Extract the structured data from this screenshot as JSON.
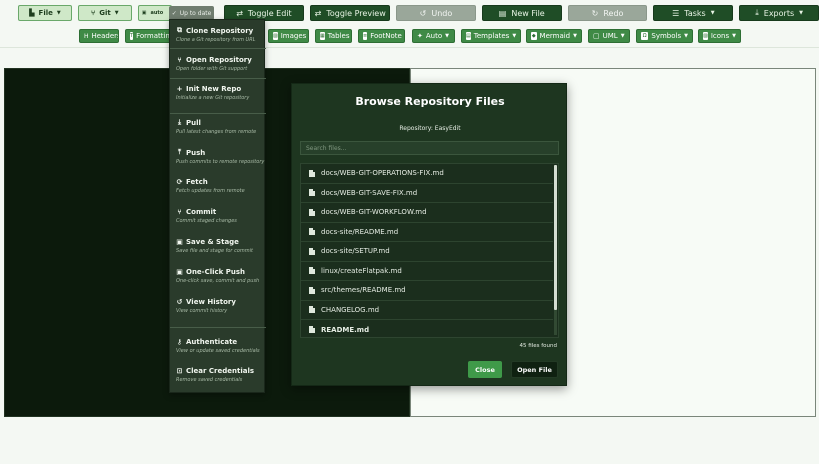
{
  "toolbar": {
    "file_label": "File",
    "git_label": "Git",
    "mode_label": "auto",
    "status_label": "Up to date",
    "toggle_edit": "Toggle Edit",
    "toggle_preview": "Toggle Preview",
    "undo": "Undo",
    "new_file": "New File",
    "redo": "Redo",
    "tasks": "Tasks",
    "exports": "Exports"
  },
  "insert_bar": {
    "headers": "Headers",
    "formatting": "Formatting",
    "images": "Images",
    "tables": "Tables",
    "footnote": "FootNote",
    "auto": "Auto",
    "templates": "Templates",
    "mermaid": "Mermaid",
    "uml": "UML",
    "symbols": "Symbols",
    "icons": "Icons"
  },
  "git_menu": {
    "items": [
      {
        "title": "Clone Repository",
        "desc": "Clone a Git repository from URL"
      },
      {
        "title": "Open Repository",
        "desc": "Open folder with Git support"
      },
      {
        "title": "Init New Repo",
        "desc": "Initialize a new Git repository"
      },
      {
        "title": "Pull",
        "desc": "Pull latest changes from remote"
      },
      {
        "title": "Push",
        "desc": "Push commits to remote repository"
      },
      {
        "title": "Fetch",
        "desc": "Fetch updates from remote"
      },
      {
        "title": "Commit",
        "desc": "Commit staged changes"
      },
      {
        "title": "Save & Stage",
        "desc": "Save file and stage for commit"
      },
      {
        "title": "One-Click Push",
        "desc": "One-click save, commit and push"
      },
      {
        "title": "View History",
        "desc": "View commit history"
      },
      {
        "title": "Authenticate",
        "desc": "View or update saved credentials"
      },
      {
        "title": "Clear Credentials",
        "desc": "Remove saved credentials"
      }
    ]
  },
  "modal": {
    "title": "Browse Repository Files",
    "repo_text": "Repository: EasyEdit",
    "search_placeholder": "Search files...",
    "files": [
      "docs/WEB-GIT-OPERATIONS-FIX.md",
      "docs/WEB-GIT-SAVE-FIX.md",
      "docs/WEB-GIT-WORKFLOW.md",
      "docs-site/README.md",
      "docs-site/SETUP.md",
      "linux/createFlatpak.md",
      "src/themes/README.md",
      "CHANGELOG.md",
      "README.md"
    ],
    "count_text": "45 files found",
    "close_label": "Close",
    "open_label": "Open File"
  }
}
